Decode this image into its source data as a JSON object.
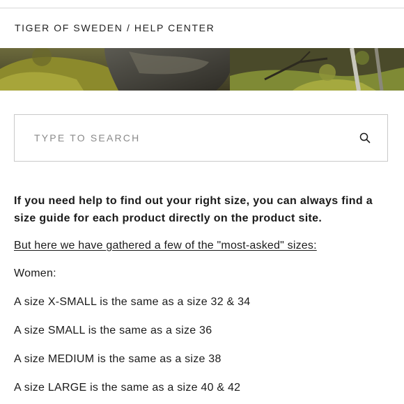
{
  "header": {
    "breadcrumb": "TIGER OF SWEDEN / HELP CENTER"
  },
  "search": {
    "placeholder": "TYPE TO SEARCH",
    "icon": "search-icon"
  },
  "content": {
    "intro": "If you need help to find out your right size, you can always find a size guide for each product directly on the product site.",
    "gathered_link": "But here we have gathered a few of the \"most-asked\" sizes:",
    "section_women": "Women:",
    "sizes": [
      "A size X-SMALL is the same as a size 32 & 34",
      "A size SMALL is the same as a size 36",
      "A size MEDIUM is the same as a size 38",
      "A size LARGE is the same as a size 40 & 42"
    ]
  }
}
